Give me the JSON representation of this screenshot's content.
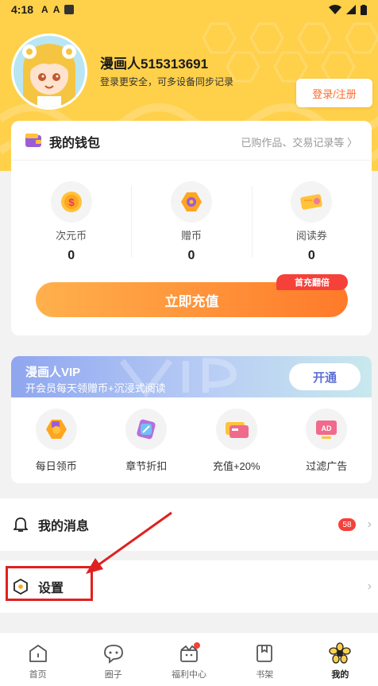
{
  "status_bar": {
    "time": "4:18",
    "icon1": "A",
    "icon2": "A"
  },
  "profile": {
    "username": "漫画人515313691",
    "subtitle": "登录更安全，可多设备同步记录",
    "login_button": "登录/注册"
  },
  "wallet": {
    "title": "我的钱包",
    "link": "已购作品、交易记录等 〉",
    "items": [
      {
        "label": "次元币",
        "value": "0",
        "icon": "coin-icon"
      },
      {
        "label": "赠币",
        "value": "0",
        "icon": "gift-coin-icon"
      },
      {
        "label": "阅读券",
        "value": "0",
        "icon": "ticket-icon"
      }
    ],
    "recharge_button": "立即充值",
    "badge": "首充翻倍"
  },
  "vip": {
    "title": "漫画人VIP",
    "subtitle": "开会员每天领赠币+沉浸式阅读",
    "open_button": "开通",
    "perks": [
      {
        "label": "每日领币",
        "icon": "daily-coin-icon"
      },
      {
        "label": "章节折扣",
        "icon": "discount-icon"
      },
      {
        "label": "充值+20%",
        "icon": "card-icon"
      },
      {
        "label": "过滤广告",
        "icon": "ad-icon"
      }
    ]
  },
  "menu": {
    "messages_label": "我的消息",
    "messages_count": "58",
    "settings_label": "设置"
  },
  "tabs": [
    {
      "label": "首页"
    },
    {
      "label": "圈子"
    },
    {
      "label": "福利中心"
    },
    {
      "label": "书架"
    },
    {
      "label": "我的"
    }
  ],
  "colors": {
    "header": "#ffd04a",
    "accent": "#ff7a2a",
    "badge": "#f5413a"
  }
}
